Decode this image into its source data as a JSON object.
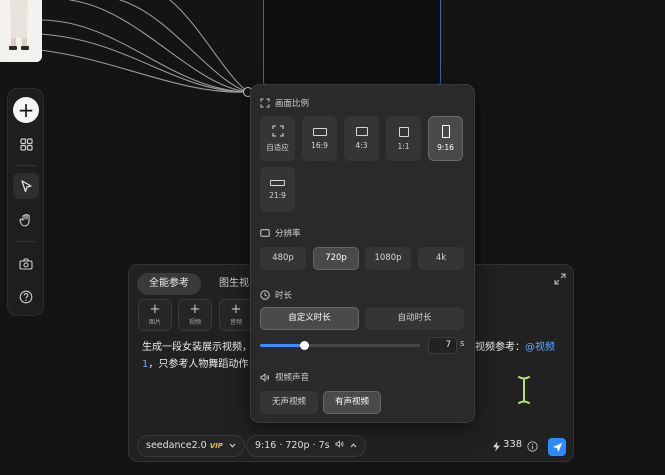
{
  "colors": {
    "canvas_bg": "#141414",
    "panel_bg": "#2a2a2a",
    "accent": "#2e8bff",
    "link": "#5fa8ff",
    "vip": "#e8c04a",
    "node_border": "#3b63b8"
  },
  "toolbar": {
    "icons": [
      "add-icon",
      "grid-icon",
      "cursor-icon",
      "hand-icon",
      "camera-icon",
      "help-icon"
    ],
    "add_glyph": "+"
  },
  "popup": {
    "aspect": {
      "label": "画面比例",
      "options": [
        {
          "label": "自适应",
          "icon": "fit-icon"
        },
        {
          "label": "16:9",
          "icon": "ratio-16-9-icon"
        },
        {
          "label": "4:3",
          "icon": "ratio-4-3-icon"
        },
        {
          "label": "1:1",
          "icon": "ratio-1-1-icon"
        },
        {
          "label": "9:16",
          "icon": "ratio-9-16-icon",
          "selected": true
        },
        {
          "label": "21:9",
          "icon": "ratio-21-9-icon"
        }
      ]
    },
    "resolution": {
      "label": "分辨率",
      "options": [
        "480p",
        "720p",
        "1080p",
        "4k"
      ],
      "selected": "720p"
    },
    "duration": {
      "label": "时长",
      "modes": [
        "自定义时长",
        "自动时长"
      ],
      "selected_mode": "自定义时长",
      "value": "7",
      "unit": "s",
      "slider_fraction": 0.28
    },
    "audio": {
      "label": "视频声音",
      "options": [
        "无声视频",
        "有声视频"
      ],
      "selected": "有声视频"
    }
  },
  "composer": {
    "tabs": [
      "全能参考",
      "图生视"
    ],
    "active_tab": "全能参考",
    "uploads": [
      {
        "plus": "+",
        "label": "图片"
      },
      {
        "plus": "+",
        "label": "视频"
      },
      {
        "plus": "+",
        "label": "音频"
      }
    ],
    "prompt_line1_left": "生成一段女装展示视频，",
    "prompt_line1_right": "视频参考：",
    "prompt_mention": "@视频",
    "prompt_line2_num": "1",
    "prompt_line2_text": "，只参考人物舞蹈动作，",
    "model": {
      "name": "seedance2.0",
      "badge": "VIP"
    },
    "settings_summary": "9:16 · 720p · 7s",
    "credits": "338"
  }
}
